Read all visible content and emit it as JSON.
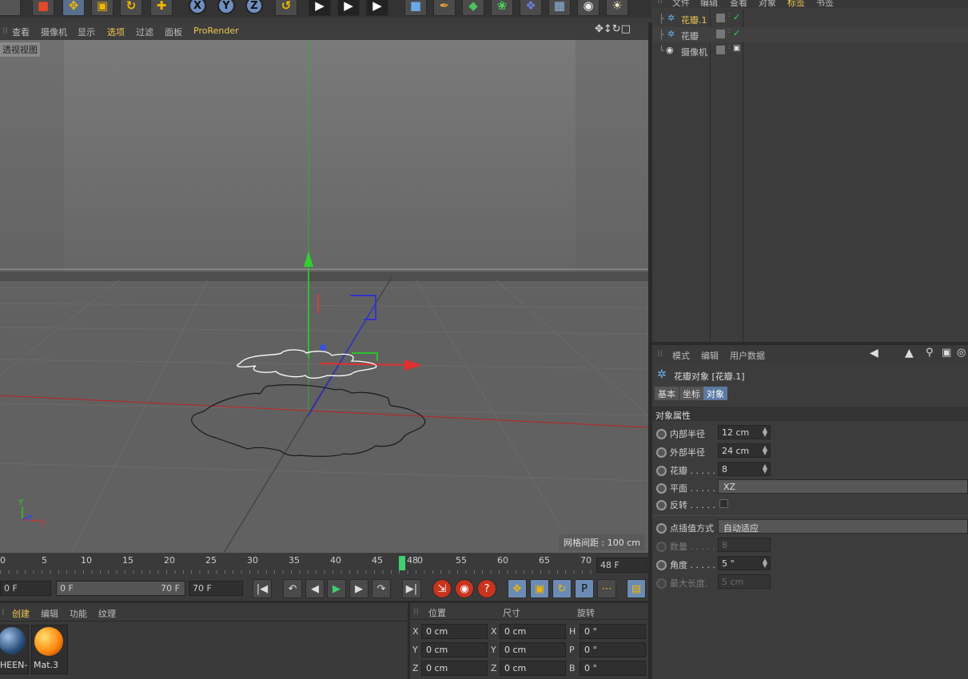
{
  "viewport_menu": [
    "查看",
    "摄像机",
    "显示",
    "选项",
    "过滤",
    "面板",
    "ProRender"
  ],
  "viewport_active_menu_index": 3,
  "viewport_label": "透视视图",
  "grid_info": "网格间距 : 100 cm",
  "axis_indicator": {
    "y": "Y",
    "x": "X",
    "z": "Z"
  },
  "object_manager": {
    "menu": [
      "文件",
      "编辑",
      "查看",
      "对象",
      "标签",
      "书签"
    ],
    "objects": [
      {
        "name": "花瓣.1",
        "selected": true
      },
      {
        "name": "花瓣",
        "selected": false
      },
      {
        "name": "摄像机",
        "selected": false
      }
    ]
  },
  "attribute_manager": {
    "menu": [
      "模式",
      "编辑",
      "用户数据"
    ],
    "title": "花瓣对象 [花瓣.1]",
    "tabs": [
      "基本",
      "坐标",
      "对象"
    ],
    "active_tab_index": 2,
    "section": "对象属性",
    "props": [
      {
        "label": "内部半径",
        "value": "12 cm",
        "kind": "number"
      },
      {
        "label": "外部半径",
        "value": "24 cm",
        "kind": "number"
      },
      {
        "label": "花瓣 . . . . .",
        "value": "8",
        "kind": "number"
      },
      {
        "label": "平面 . . . . .",
        "value": "XZ",
        "kind": "dropdown"
      },
      {
        "label": "反转 . . . . .",
        "value": "",
        "kind": "checkbox"
      }
    ],
    "props2": [
      {
        "label": "点插值方式",
        "value": "自动适应",
        "kind": "dropdown",
        "dim": false
      },
      {
        "label": "数量 . . . . .",
        "value": "8",
        "kind": "number",
        "dim": true
      },
      {
        "label": "角度 . . . . .",
        "value": "5 °",
        "kind": "number",
        "dim": false
      },
      {
        "label": "最大长度.",
        "value": "5 cm",
        "kind": "number",
        "dim": true
      }
    ]
  },
  "timeline": {
    "ticks": [
      "0",
      "5",
      "10",
      "15",
      "20",
      "25",
      "30",
      "35",
      "40",
      "45",
      "48",
      "0",
      "55",
      "60",
      "65",
      "70"
    ],
    "current_frame_label": "48",
    "end_field": "48 F"
  },
  "transport": {
    "start": "0 F",
    "range_start": "0 F",
    "range_end": "70 F",
    "end": "70 F"
  },
  "material_manager": {
    "menu": [
      "创建",
      "编辑",
      "功能",
      "纹理"
    ],
    "materials": [
      {
        "name": "HEEN-",
        "color": "#2a4f7a"
      },
      {
        "name": "Mat.3",
        "color": "#ff8a10"
      }
    ]
  },
  "coordinates": {
    "headers": [
      "位置",
      "尺寸",
      "旋转"
    ],
    "rows": [
      {
        "a": "X",
        "av": "0 cm",
        "b": "X",
        "bv": "0 cm",
        "c": "H",
        "cv": "0 °"
      },
      {
        "a": "Y",
        "av": "0 cm",
        "b": "Y",
        "bv": "0 cm",
        "c": "P",
        "cv": "0 °"
      },
      {
        "a": "Z",
        "av": "0 cm",
        "b": "Z",
        "bv": "0 cm",
        "c": "B",
        "cv": "0 °"
      }
    ]
  }
}
